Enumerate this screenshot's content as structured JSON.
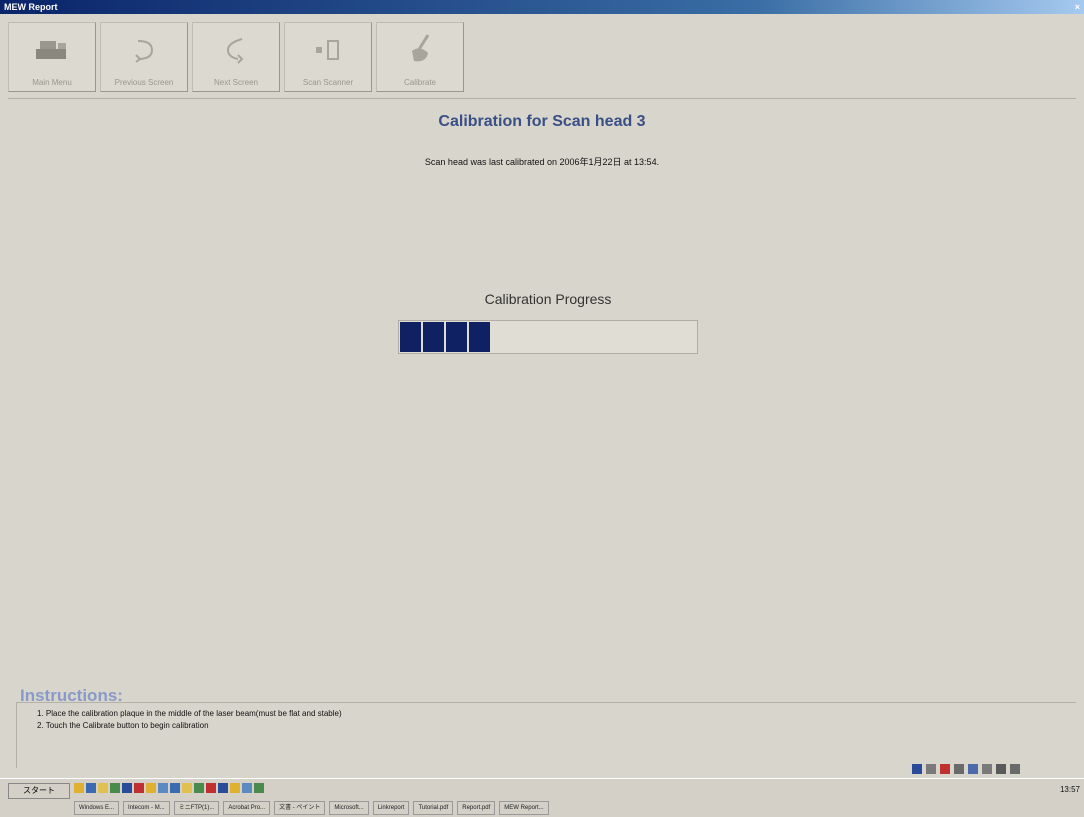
{
  "window": {
    "title": "MEW Report"
  },
  "toolbar": {
    "buttons": [
      {
        "label": "Main Menu",
        "icon": "machine-icon"
      },
      {
        "label": "Previous Screen",
        "icon": "back-arrow-icon"
      },
      {
        "label": "Next Screen",
        "icon": "forward-arrow-icon"
      },
      {
        "label": "Scan Scanner",
        "icon": "scanner-icon"
      },
      {
        "label": "Calibrate",
        "icon": "calibrate-icon"
      }
    ]
  },
  "main": {
    "title": "Calibration for Scan head 3",
    "subtitle": "Scan head was last calibrated on 2006年1月22日 at 13:54."
  },
  "progress": {
    "label": "Calibration Progress",
    "fraction": 0.31,
    "segments_filled": 4,
    "fill_color": "#0f2063"
  },
  "instructions": {
    "title": "Instructions:",
    "lines": [
      "1. Place the calibration plaque in the middle of the laser beam(must be flat and stable)",
      "2. Touch the Calibrate button to begin calibration"
    ]
  },
  "taskbar": {
    "start_label": "スタート",
    "tasks": [
      "Windows E...",
      "Intecom - M...",
      "ミニFTP(1)...",
      "Acrobat Pro...",
      "文書 - ペイント",
      "Microsoft...",
      "Linkreport",
      "Tutorial.pdf",
      "Report.pdf",
      "MEW Report..."
    ],
    "clock": "13:57"
  },
  "colors": {
    "accent": "#3a4f86",
    "instructions_title": "#8a9ac8"
  }
}
